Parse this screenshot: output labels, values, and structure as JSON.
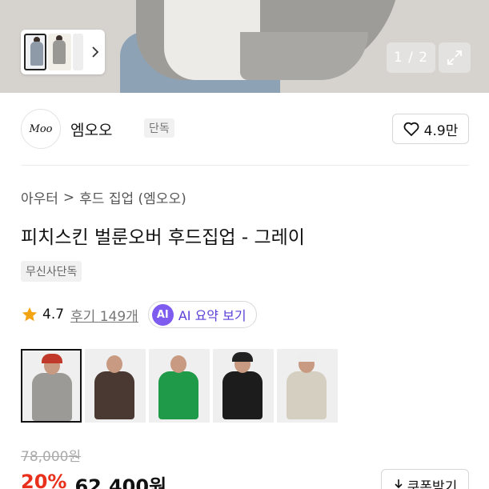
{
  "hero": {
    "page_counter": "1 / 2"
  },
  "brand": {
    "logo_text": "Moo",
    "name": "엠오오",
    "tag": "단독",
    "likes": "4.9만"
  },
  "breadcrumb": {
    "category": "아우터",
    "separator": ">",
    "subcategory": "후드 집업 (엠오오)"
  },
  "product": {
    "title": "피치스킨 벌룬오버 후드집업 - 그레이",
    "badge": "무신사단독",
    "rating": "4.7",
    "reviews": "후기 149개",
    "ai_badge": "AI",
    "ai_label": "AI 요약 보기"
  },
  "color_options": [
    {
      "color": "#9c9a96",
      "hat": "#c0392b",
      "selected": true
    },
    {
      "color": "#4a3832",
      "hat": null,
      "selected": false
    },
    {
      "color": "#1f9a48",
      "hat": null,
      "selected": false
    },
    {
      "color": "#1c1c1c",
      "hat": "#222222",
      "selected": false
    },
    {
      "color": "#d4cfc0",
      "hat": "#eeeeee",
      "selected": false
    }
  ],
  "price": {
    "original": "78,000원",
    "discount": "20%",
    "sale": "62,400원",
    "coupon_label": "쿠폰받기"
  },
  "colors": {
    "accent_red": "#e8301c",
    "ai_purple": "#7f5cf0"
  }
}
